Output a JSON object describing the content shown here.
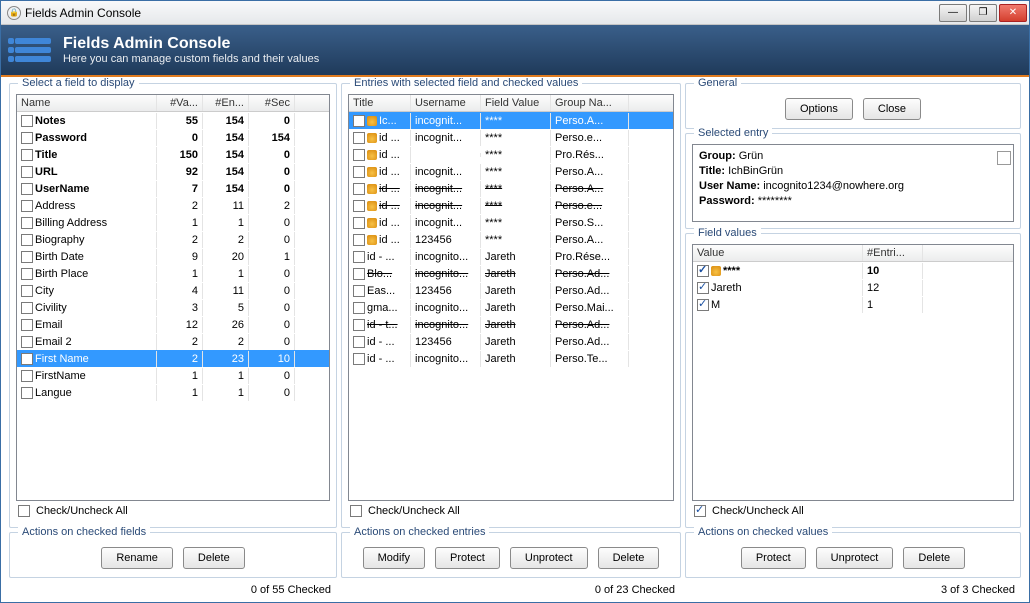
{
  "window_title": "Fields Admin Console",
  "header": {
    "title": "Fields Admin Console",
    "subtitle": "Here you can manage custom fields and their values"
  },
  "winbtns": {
    "min": "—",
    "max": "❐",
    "close": "✕"
  },
  "left": {
    "legend": "Select a field to display",
    "cols": [
      "Name",
      "#Va...",
      "#En...",
      "#Sec"
    ],
    "rows": [
      {
        "name": "Notes",
        "va": "55",
        "en": "154",
        "sec": "0",
        "bold": true
      },
      {
        "name": "Password",
        "va": "0",
        "en": "154",
        "sec": "154",
        "bold": true
      },
      {
        "name": "Title",
        "va": "150",
        "en": "154",
        "sec": "0",
        "bold": true
      },
      {
        "name": "URL",
        "va": "92",
        "en": "154",
        "sec": "0",
        "bold": true
      },
      {
        "name": "UserName",
        "va": "7",
        "en": "154",
        "sec": "0",
        "bold": true
      },
      {
        "name": "Address",
        "va": "2",
        "en": "11",
        "sec": "2"
      },
      {
        "name": "Billing Address",
        "va": "1",
        "en": "1",
        "sec": "0"
      },
      {
        "name": "Biography",
        "va": "2",
        "en": "2",
        "sec": "0"
      },
      {
        "name": "Birth Date",
        "va": "9",
        "en": "20",
        "sec": "1"
      },
      {
        "name": "Birth Place",
        "va": "1",
        "en": "1",
        "sec": "0"
      },
      {
        "name": "City",
        "va": "4",
        "en": "11",
        "sec": "0"
      },
      {
        "name": "Civility",
        "va": "3",
        "en": "5",
        "sec": "0"
      },
      {
        "name": "Email",
        "va": "12",
        "en": "26",
        "sec": "0"
      },
      {
        "name": "Email 2",
        "va": "2",
        "en": "2",
        "sec": "0"
      },
      {
        "name": "First Name",
        "va": "2",
        "en": "23",
        "sec": "10",
        "sel": true
      },
      {
        "name": "FirstName",
        "va": "1",
        "en": "1",
        "sec": "0"
      },
      {
        "name": "Langue",
        "va": "1",
        "en": "1",
        "sec": "0"
      }
    ],
    "check_label": "Check/Uncheck All",
    "actions_legend": "Actions on checked fields",
    "btn_rename": "Rename",
    "btn_delete": "Delete",
    "status": "0 of 55 Checked"
  },
  "mid": {
    "legend": "Entries with selected field and checked values",
    "cols": [
      "Title",
      "Username",
      "Field Value",
      "Group Na..."
    ],
    "rows": [
      {
        "t": "Ic...",
        "u": "incognit...",
        "f": "****",
        "g": "Perso.A...",
        "lock": true,
        "sel": true
      },
      {
        "t": "id ...",
        "u": "incognit...",
        "f": "****",
        "g": "Perso.e...",
        "lock": true
      },
      {
        "t": "id ...",
        "u": "",
        "f": "****",
        "g": "Pro.Rés...",
        "lock": true
      },
      {
        "t": "id ...",
        "u": "incognit...",
        "f": "****",
        "g": "Perso.A...",
        "lock": true
      },
      {
        "t": "id ...",
        "u": "incognit...",
        "f": "****",
        "g": "Perso.A...",
        "lock": true,
        "strike": true
      },
      {
        "t": "id ...",
        "u": "incognit...",
        "f": "****",
        "g": "Perso.e...",
        "lock": true,
        "strike": true
      },
      {
        "t": "id ...",
        "u": "incognit...",
        "f": "****",
        "g": "Perso.S...",
        "lock": true
      },
      {
        "t": "id ...",
        "u": "123456",
        "f": "****",
        "g": "Perso.A...",
        "lock": true
      },
      {
        "t": "id - ...",
        "u": "incognito...",
        "f": "Jareth",
        "g": "Pro.Rése..."
      },
      {
        "t": "Blo...",
        "u": "incognito...",
        "f": "Jareth",
        "g": "Perso.Ad...",
        "strike": true
      },
      {
        "t": "Eas...",
        "u": "123456",
        "f": "Jareth",
        "g": "Perso.Ad..."
      },
      {
        "t": "gma...",
        "u": "incognito...",
        "f": "Jareth",
        "g": "Perso.Mai..."
      },
      {
        "t": "id - t...",
        "u": "incognito...",
        "f": "Jareth",
        "g": "Perso.Ad...",
        "strike": true
      },
      {
        "t": "id - ...",
        "u": "123456",
        "f": "Jareth",
        "g": "Perso.Ad..."
      },
      {
        "t": "id - ...",
        "u": "incognito...",
        "f": "Jareth",
        "g": "Perso.Te..."
      }
    ],
    "check_label": "Check/Uncheck All",
    "actions_legend": "Actions on checked entries",
    "btn_modify": "Modify",
    "btn_protect": "Protect",
    "btn_unprotect": "Unprotect",
    "btn_delete": "Delete",
    "status": "0 of 23 Checked"
  },
  "right": {
    "general_legend": "General",
    "btn_options": "Options",
    "btn_close": "Close",
    "selected_legend": "Selected entry",
    "detail_group_label": "Group:",
    "detail_group": "Grün",
    "detail_title_label": "Title:",
    "detail_title": "IchBinGrün",
    "detail_user_label": "User Name:",
    "detail_user": "incognito1234@nowhere.org",
    "detail_pwd_label": "Password:",
    "detail_pwd": "********",
    "values_legend": "Field values",
    "cols": [
      "Value",
      "#Entri..."
    ],
    "rows": [
      {
        "v": "****",
        "n": "10",
        "lock": true,
        "bold": true,
        "chk": true
      },
      {
        "v": "Jareth",
        "n": "12",
        "chk": true
      },
      {
        "v": "M",
        "n": "1",
        "chk": true
      }
    ],
    "check_label": "Check/Uncheck All",
    "actions_legend": "Actions on checked values",
    "btn_protect": "Protect",
    "btn_unprotect": "Unprotect",
    "btn_delete": "Delete",
    "status": "3 of 3 Checked"
  }
}
